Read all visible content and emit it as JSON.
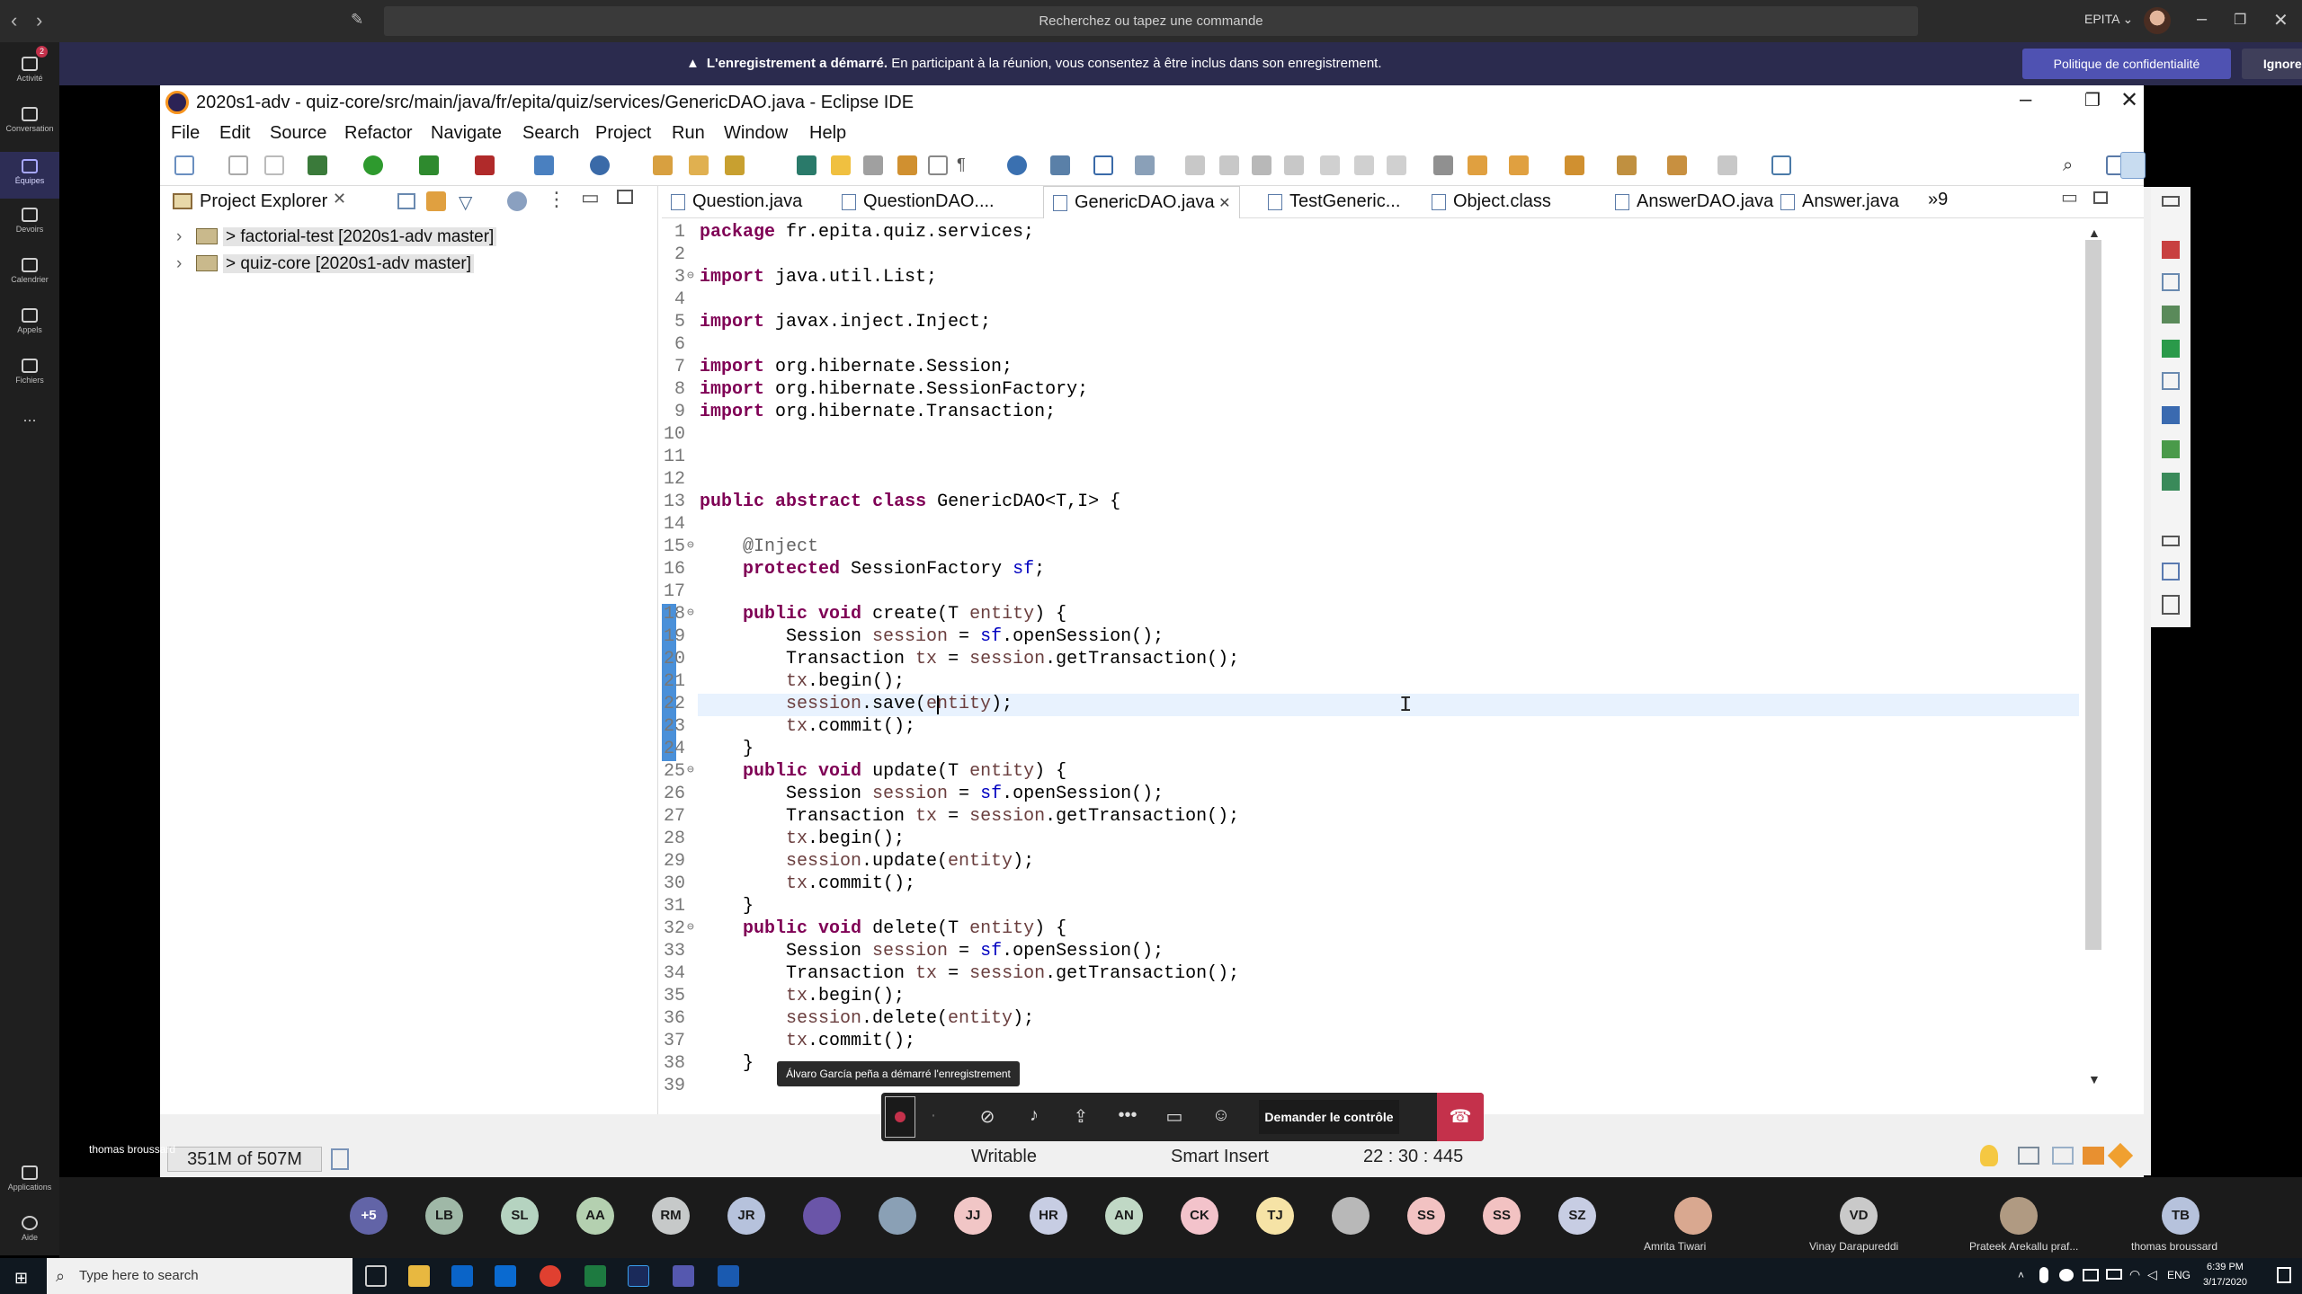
{
  "teams": {
    "search_placeholder": "Recherchez ou tapez une commande",
    "org": "EPITA ⌄",
    "rail": [
      {
        "label": "Activité",
        "icon": "bell-icon",
        "badge": "2"
      },
      {
        "label": "Conversation",
        "icon": "chat-icon"
      },
      {
        "label": "Équipes",
        "icon": "teams-icon"
      },
      {
        "label": "Devoirs",
        "icon": "assignments-icon"
      },
      {
        "label": "Calendrier",
        "icon": "calendar-icon"
      },
      {
        "label": "Appels",
        "icon": "phone-icon"
      },
      {
        "label": "Fichiers",
        "icon": "files-icon"
      },
      {
        "label": "...",
        "icon": "more-icon"
      },
      {
        "label": "Applications",
        "icon": "apps-icon"
      },
      {
        "label": "Aide",
        "icon": "help-icon"
      }
    ],
    "banner": {
      "bold": "L'enregistrement a démarré.",
      "text": "En participant à la réunion, vous consentez à être inclus dans son enregistrement.",
      "privacy_button": "Politique de confidentialité",
      "ignore_button": "Ignorer"
    },
    "recording_toast": "Álvaro García peña a démarré l'enregistrement",
    "control_button": "Demander le contrôle",
    "presenter_name": "thomas broussard",
    "participants": [
      {
        "initials": "+5",
        "color": "#6264a7",
        "text_color": "#ffffff"
      },
      {
        "initials": "LB",
        "color": "#9fb8a7"
      },
      {
        "initials": "SL",
        "color": "#b5d3c0"
      },
      {
        "initials": "AA",
        "color": "#b4d0b0"
      },
      {
        "initials": "RM",
        "color": "#c6c9c9"
      },
      {
        "initials": "JR",
        "color": "#b6c2dc"
      },
      {
        "initials": "",
        "color": "#6a55a8"
      },
      {
        "initials": "",
        "color": "#8aa0b5"
      },
      {
        "initials": "JJ",
        "color": "#f1c6c6"
      },
      {
        "initials": "HR",
        "color": "#c7cde3"
      },
      {
        "initials": "AN",
        "color": "#c0d8c5"
      },
      {
        "initials": "CK",
        "color": "#f3c3cb"
      },
      {
        "initials": "TJ",
        "color": "#f6e3a6"
      },
      {
        "initials": "",
        "color": "#b8b8b8"
      },
      {
        "initials": "SS",
        "color": "#f2c2c2"
      },
      {
        "initials": "SS",
        "color": "#f2c2c2"
      },
      {
        "initials": "SZ",
        "color": "#c7cde3"
      }
    ],
    "named_participants": [
      {
        "name": "Amrita Tiwari",
        "initials": "",
        "color": "#d9a890"
      },
      {
        "name": "Vinay Darapureddi",
        "initials": "VD",
        "color": "#c9c9c9"
      },
      {
        "name": "Prateek Arekallu praf...",
        "initials": "",
        "color": "#b09a82"
      },
      {
        "name": "thomas broussard",
        "initials": "TB",
        "color": "#b6c2dc"
      }
    ]
  },
  "eclipse": {
    "title": "2020s1-adv - quiz-core/src/main/java/fr/epita/quiz/services/GenericDAO.java - Eclipse IDE",
    "menu": [
      "File",
      "Edit",
      "Source",
      "Refactor",
      "Navigate",
      "Search",
      "Project",
      "Run",
      "Window",
      "Help"
    ],
    "project_explorer": {
      "title": "Project Explorer",
      "items": [
        "> factorial-test [2020s1-adv master]",
        "> quiz-core [2020s1-adv master]"
      ]
    },
    "tabs": [
      {
        "label": "Question.java",
        "active": false
      },
      {
        "label": "QuestionDAO....",
        "active": false
      },
      {
        "label": "GenericDAO.java",
        "active": true
      },
      {
        "label": "TestGeneric...",
        "active": false
      },
      {
        "label": "Object.class",
        "active": false
      },
      {
        "label": "AnswerDAO.java",
        "active": false
      },
      {
        "label": "Answer.java",
        "active": false
      }
    ],
    "tabs_overflow": "»9",
    "code_lines": [
      "package fr.epita.quiz.services;",
      "",
      "import java.util.List;",
      "",
      "import javax.inject.Inject;",
      "",
      "import org.hibernate.Session;",
      "import org.hibernate.SessionFactory;",
      "import org.hibernate.Transaction;",
      "",
      "",
      "",
      "public abstract class GenericDAO<T,I> {",
      "",
      "    @Inject",
      "    protected SessionFactory sf;",
      "",
      "    public void create(T entity) {",
      "        Session session = sf.openSession();",
      "        Transaction tx = session.getTransaction();",
      "        tx.begin();",
      "        session.save(entity);",
      "        tx.commit();",
      "    }",
      "    public void update(T entity) {",
      "        Session session = sf.openSession();",
      "        Transaction tx = session.getTransaction();",
      "        tx.begin();",
      "        session.update(entity);",
      "        tx.commit();",
      "    }",
      "    public void delete(T entity) {",
      "        Session session = sf.openSession();",
      "        Transaction tx = session.getTransaction();",
      "        tx.begin();",
      "        session.delete(entity);",
      "        tx.commit();",
      "    }",
      ""
    ],
    "fold_markers": [
      3,
      15,
      18,
      25,
      32
    ],
    "cursor_line": 22,
    "status": {
      "heap": "351M of 507M",
      "writable": "Writable",
      "insert_mode": "Smart Insert",
      "position": "22 : 30 : 445"
    }
  },
  "taskbar": {
    "search_placeholder": "Type here to search",
    "lang": "ENG",
    "time": "6:39 PM",
    "date": "3/17/2020"
  }
}
